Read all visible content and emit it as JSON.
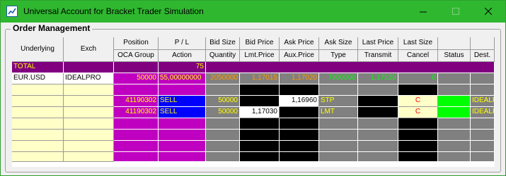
{
  "window": {
    "title": "Universal Account for Bracket Trader Simulation",
    "icon": "chart-app-icon",
    "controls": [
      "minimize-icon",
      "maximize-icon",
      "close-icon"
    ]
  },
  "group": {
    "label": "Order Management"
  },
  "colors": {
    "titlebar": "#2fb82f",
    "magenta": "#c000c0",
    "purple": "#800080",
    "gray": "#808080",
    "black": "#000000",
    "blue": "#0000ff",
    "cream": "#ffffc8",
    "green": "#00ff00",
    "yellow_text": "#ffff00",
    "olive_text": "#c0c000",
    "green_text": "#00ff00"
  },
  "headers": {
    "underlying": "Underlying",
    "exch": "Exch",
    "position": "Position",
    "oca_group": "OCA Group",
    "pl": "P / L",
    "action": "Action",
    "bid_size": "Bid Size",
    "quantity": "Quantity",
    "bid_price": "Bid Price",
    "lmt_price": "Lmt.Price",
    "ask_price": "Ask Price",
    "aux_price": "Aux.Price",
    "ask_size": "Ask Size",
    "type": "Type",
    "last_price": "Last Price",
    "transmit": "Transmit",
    "last_size": "Last Size",
    "cancel": "Cancel",
    "status": "Status",
    "dest": "Dest."
  },
  "rows": {
    "total": {
      "label": "TOTAL",
      "pl": "75"
    },
    "instrument": {
      "underlying": "EUR.USD",
      "exch": "IDEALPRO",
      "position": "50000",
      "pl": "55,00000000",
      "bid_size": "2050000",
      "bid_price": "1,17015",
      "ask_price": "1,17020",
      "ask_size": "7000000",
      "last_price": "1,17020",
      "last_size": "0"
    },
    "order_stop": {
      "oca_group": "41190302",
      "action": "SELL",
      "quantity": "50000",
      "aux_price": "1,16960",
      "type": "STP",
      "cancel": "C",
      "dest": "IDEALPRO"
    },
    "order_limit": {
      "oca_group": "41190302",
      "action": "SELL",
      "quantity": "50000",
      "lmt_price": "1,17030",
      "type": "LMT",
      "cancel": "C",
      "dest": "IDEALPRO"
    }
  }
}
